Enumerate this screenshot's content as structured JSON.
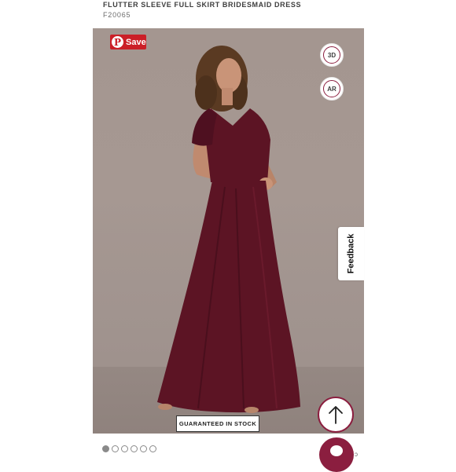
{
  "product": {
    "title": "FLUTTER SLEEVE FULL SKIRT BRIDESMAID DRESS",
    "sku": "F20065"
  },
  "gallery": {
    "save_label": "Save",
    "view_3d_label": "3D",
    "view_ar_label": "AR",
    "stock_badge": "GUARANTEED IN STOCK",
    "dots_total": 6,
    "active_dot": 1
  },
  "feedback": {
    "label": "Feedback"
  },
  "icons": {
    "pinterest": "pinterest-icon",
    "view_3d": "3d-view-icon",
    "ar": "ar-icon",
    "scroll_top": "arrow-up-icon",
    "chat": "chat-icon"
  },
  "colors": {
    "accent": "#8b1e3f",
    "pinterest_red": "#cb1f27",
    "dress": "#5c1424",
    "backdrop": "#a49690"
  }
}
